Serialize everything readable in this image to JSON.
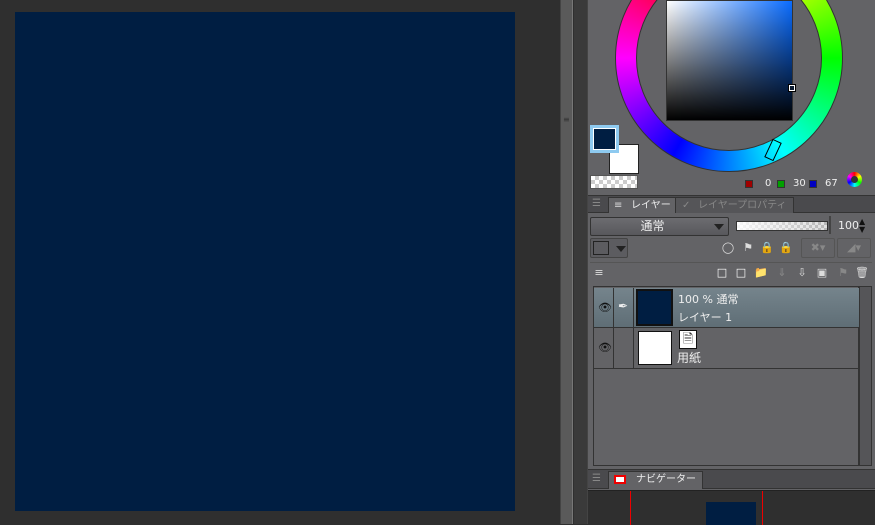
{
  "canvas": {
    "fill_color": "#001e42"
  },
  "color_panel": {
    "main_color": "#001e42",
    "sub_color": "#ffffff",
    "rgb": {
      "r": "0",
      "g": "30",
      "b": "67"
    }
  },
  "layer_panel": {
    "tabs": [
      {
        "label": "レイヤー"
      },
      {
        "label": "レイヤープロパティ"
      }
    ],
    "blend_mode": "通常",
    "opacity": "100",
    "layers": [
      {
        "info": "100 % 通常",
        "name": "レイヤー 1",
        "thumb": "#001e42",
        "selected": true
      },
      {
        "name": "用紙",
        "thumb": "#ffffff",
        "selected": false
      }
    ]
  },
  "navigator": {
    "tab_label": "ナビゲーター"
  }
}
